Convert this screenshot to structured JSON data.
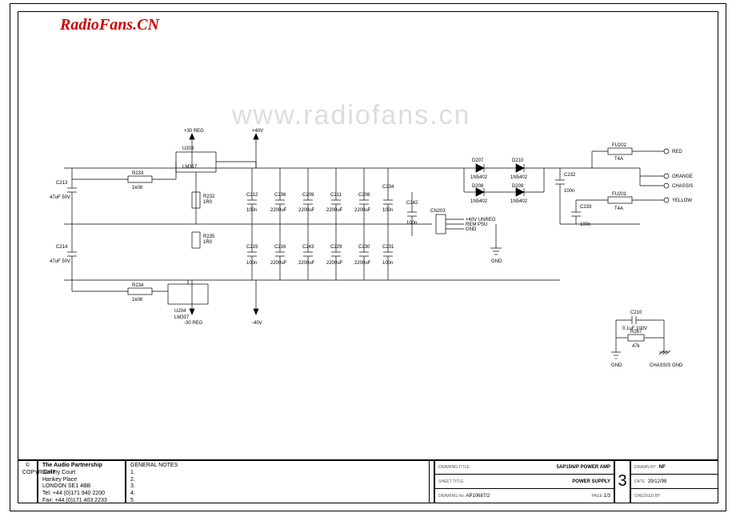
{
  "logo": "RadioFans.CN",
  "watermark": "www.radiofans.cn",
  "rails": {
    "plus30reg": "+30 REG",
    "minus30reg": "-30 REG",
    "plus40v": "+40V",
    "minus40v": "-40V"
  },
  "regs": {
    "u203": {
      "ref": "U203",
      "part": "LM317"
    },
    "u204": {
      "ref": "U204",
      "part": "LM337"
    }
  },
  "reg_r": {
    "r233": {
      "ref": "R233",
      "val": "1k08"
    },
    "r232": {
      "ref": "R232",
      "val": "1R0"
    },
    "r235": {
      "ref": "R235",
      "val": "1R0"
    },
    "r234": {
      "ref": "R234",
      "val": "1k08"
    }
  },
  "reg_c": {
    "c213": {
      "ref": "C213",
      "val": "47uF 50V"
    },
    "c214": {
      "ref": "C214",
      "val": "47uF 50V"
    }
  },
  "bank_pos": {
    "c212": {
      "ref": "C212",
      "val": "100n"
    },
    "c236": {
      "ref": "C236",
      "val": "2200uF"
    },
    "c209": {
      "ref": "C209",
      "val": "2200uF"
    },
    "c211": {
      "ref": "C211",
      "val": "2200uF"
    },
    "c208": {
      "ref": "C208",
      "val": "2200uF"
    },
    "c234": {
      "ref": "C234",
      "val": "100n"
    },
    "c242": {
      "ref": "C242",
      "val": "100n"
    }
  },
  "bank_neg": {
    "c215": {
      "ref": "C215",
      "val": "100n"
    },
    "c216": {
      "ref": "C216",
      "val": "2200uF"
    },
    "c243": {
      "ref": "C243",
      "val": "2200uF"
    },
    "c229": {
      "ref": "C229",
      "val": "2200uF"
    },
    "c230": {
      "ref": "C230",
      "val": "2200uF"
    },
    "c231": {
      "ref": "C231",
      "val": "100n"
    }
  },
  "bridge": {
    "d207": {
      "ref": "D207",
      "val": "1N5402"
    },
    "d210": {
      "ref": "D210",
      "val": "1N5402"
    },
    "d208": {
      "ref": "D208",
      "val": "1N5402"
    },
    "d209": {
      "ref": "D209",
      "val": "1N5402"
    }
  },
  "conn": {
    "cn203": {
      "ref": "CN203",
      "p1": "+40V UNREG",
      "p2": "REM PSU",
      "p3": "GND"
    },
    "gnd": "GND"
  },
  "fuses": {
    "fu202": {
      "ref": "FU202",
      "val": "T4A"
    },
    "fu201": {
      "ref": "FU201",
      "val": "T4A"
    }
  },
  "out_c": {
    "c232": {
      "ref": "C232",
      "val": "100n"
    },
    "c233": {
      "ref": "C233",
      "val": "100n"
    }
  },
  "wires": {
    "red": "RED",
    "orange": "ORANGE",
    "chassis": "CHASSIS",
    "yellow": "YELLOW"
  },
  "sub": {
    "c210": {
      "ref": "C210",
      "val": "0.1uF 100V"
    },
    "r267": {
      "ref": "R267",
      "val": "47k"
    },
    "gnd": "GND",
    "cgnd": "CHASSIS GND"
  },
  "title_block": {
    "copyright": "© COPYRIGHT",
    "company": {
      "name": "The Audio Partnership",
      "l1": "Gallery Court",
      "l2": "Hankey Place",
      "l3": "LONDON SE1 4BB",
      "l4": "Tel: +44 (0)171 940 2200",
      "l5": "Fax: +44 (0)171 403 2233"
    },
    "notes": {
      "h": "GENERAL NOTES",
      "i1": "1.",
      "i2": "2.",
      "i3": "3.",
      "i4": "4.",
      "i5": "5."
    },
    "drawing_title": {
      "k": "DRAWING TITLE",
      "v": "5AP15N/P POWER AMP"
    },
    "sheet_title": {
      "k": "SHEET TITLE",
      "v": "POWER SUPPLY"
    },
    "drawing_no": {
      "k": "DRAWING No.",
      "v": "AP10687/2"
    },
    "page": {
      "k": "PAGE",
      "v": "1/3"
    },
    "rev": "3",
    "drawn_by": {
      "k": "DRAWN BY",
      "v": "NF"
    },
    "date": {
      "k": "DATE",
      "v": "29/12/98"
    },
    "checked_by": {
      "k": "CHECKED BY",
      "v": ""
    }
  }
}
